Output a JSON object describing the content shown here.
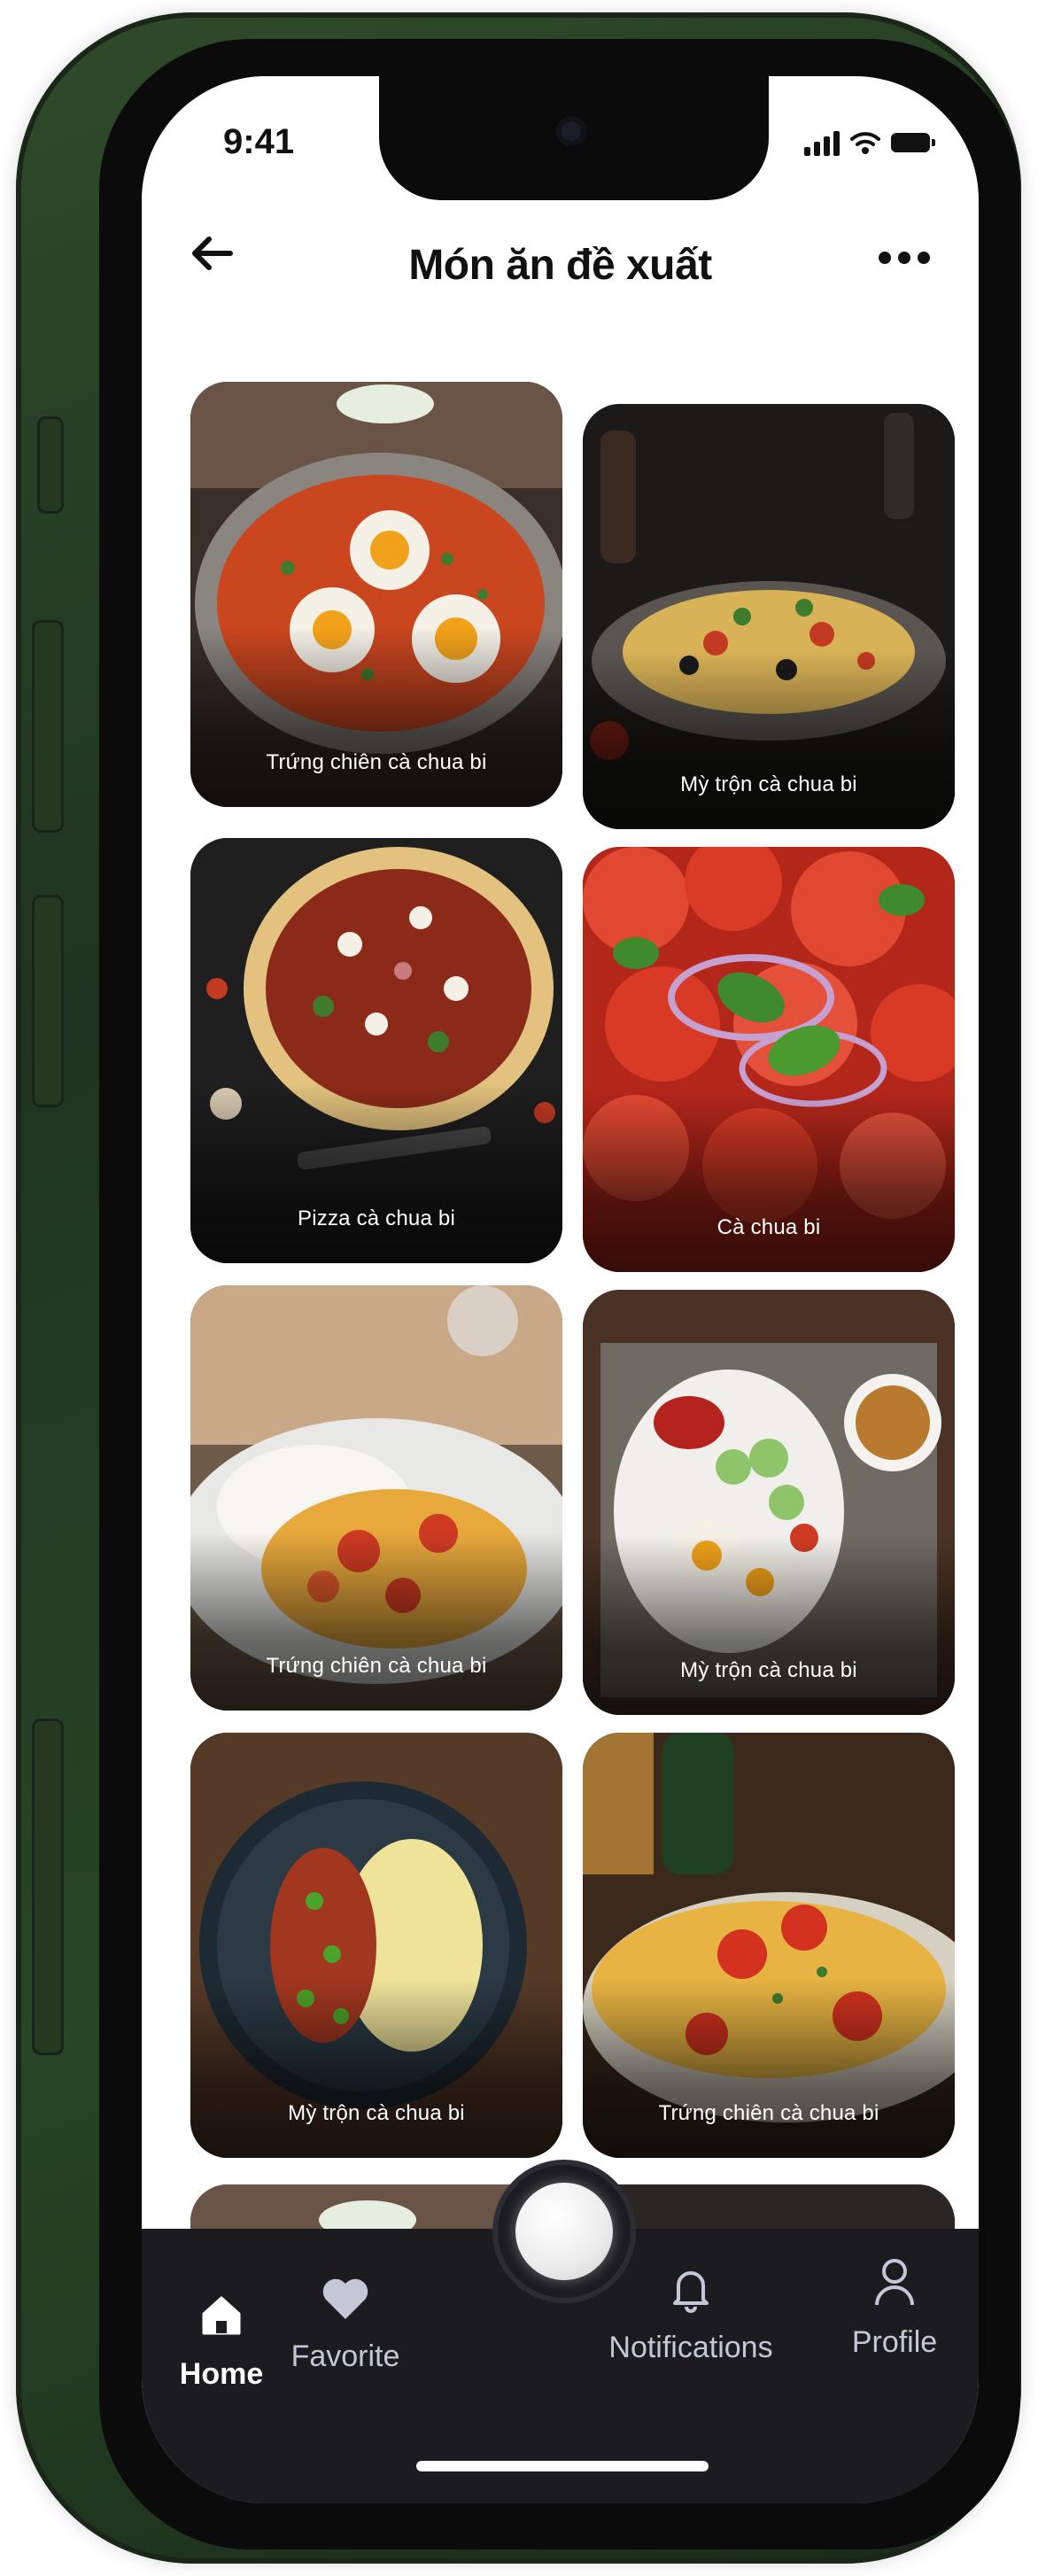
{
  "status_bar": {
    "time": "9:41"
  },
  "header": {
    "title": "Món ăn đề xuất"
  },
  "dishes": [
    {
      "label": "Trứng chiên cà chua bi"
    },
    {
      "label": "Mỳ trộn cà chua bi"
    },
    {
      "label": "Pizza cà chua bi"
    },
    {
      "label": "Cà chua bi"
    },
    {
      "label": "Trứng chiên cà chua bi"
    },
    {
      "label": "Mỳ trộn cà chua bi"
    },
    {
      "label": "Mỳ trộn cà chua bi"
    },
    {
      "label": "Trứng chiên cà chua bi"
    }
  ],
  "tabbar": {
    "home": "Home",
    "favorite": "Favorite",
    "notifications": "Notifications",
    "profile": "Profile"
  },
  "colors": {
    "tabbar_bg": "#1c1c20",
    "tab_inactive": "#c4c8d6",
    "phone_frame": "#1f3420"
  }
}
